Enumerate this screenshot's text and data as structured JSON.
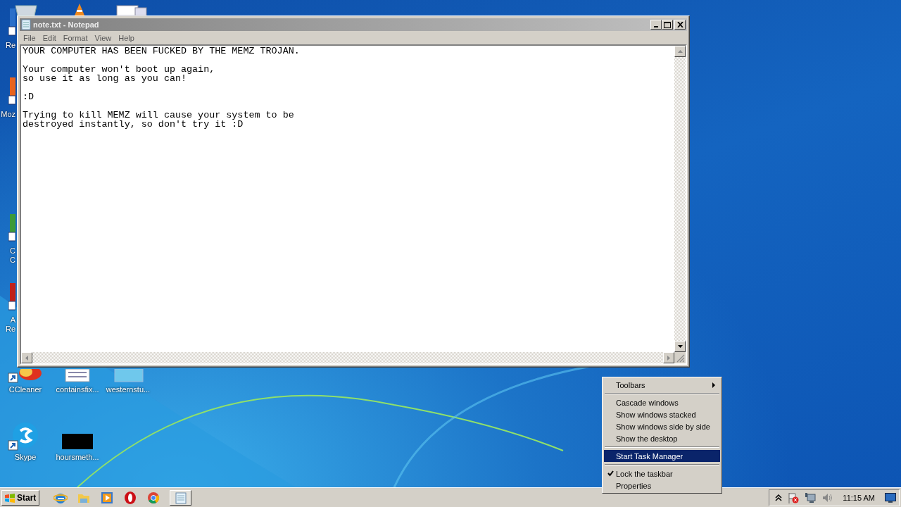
{
  "desktop_icons_partial": [
    {
      "lines": [
        "Re"
      ]
    },
    {
      "lines": [
        "Moz"
      ]
    },
    {
      "lines": [
        "C",
        "C"
      ]
    },
    {
      "lines": [
        "A",
        "Re"
      ]
    }
  ],
  "desktop_icons": [
    {
      "kind": "cleaner",
      "label": "CCleaner",
      "shortcut": true
    },
    {
      "kind": "document",
      "label": "containsfix...",
      "shortcut": false
    },
    {
      "kind": "blank",
      "label": "westernstu...",
      "shortcut": false
    },
    {
      "kind": "skype",
      "label": "Skype",
      "shortcut": true
    },
    {
      "kind": "dark",
      "label": "hoursmeth...",
      "shortcut": false
    }
  ],
  "notepad": {
    "title": "note.txt - Notepad",
    "menu": [
      "File",
      "Edit",
      "Format",
      "View",
      "Help"
    ],
    "text": "YOUR COMPUTER HAS BEEN FUCKED BY THE MEMZ TROJAN.\n\nYour computer won't boot up again,\nso use it as long as you can!\n\n:D\n\nTrying to kill MEMZ will cause your system to be\ndestroyed instantly, so don't try it :D"
  },
  "context_menu": [
    {
      "kind": "item",
      "label": "Toolbars",
      "submenu": true,
      "checked": false,
      "selected": false
    },
    {
      "kind": "separator"
    },
    {
      "kind": "item",
      "label": "Cascade windows",
      "submenu": false,
      "checked": false,
      "selected": false
    },
    {
      "kind": "item",
      "label": "Show windows stacked",
      "submenu": false,
      "checked": false,
      "selected": false
    },
    {
      "kind": "item",
      "label": "Show windows side by side",
      "submenu": false,
      "checked": false,
      "selected": false
    },
    {
      "kind": "item",
      "label": "Show the desktop",
      "submenu": false,
      "checked": false,
      "selected": false
    },
    {
      "kind": "separator"
    },
    {
      "kind": "item",
      "label": "Start Task Manager",
      "submenu": false,
      "checked": false,
      "selected": true
    },
    {
      "kind": "separator"
    },
    {
      "kind": "item",
      "label": "Lock the taskbar",
      "submenu": false,
      "checked": true,
      "selected": false
    },
    {
      "kind": "item",
      "label": "Properties",
      "submenu": false,
      "checked": false,
      "selected": false
    }
  ],
  "taskbar": {
    "start": "Start",
    "apps": [
      {
        "kind": "ie"
      },
      {
        "kind": "folder"
      },
      {
        "kind": "media"
      },
      {
        "kind": "opera"
      },
      {
        "kind": "chrome"
      },
      {
        "kind": "notepad"
      }
    ],
    "clock": "11:15 AM"
  }
}
